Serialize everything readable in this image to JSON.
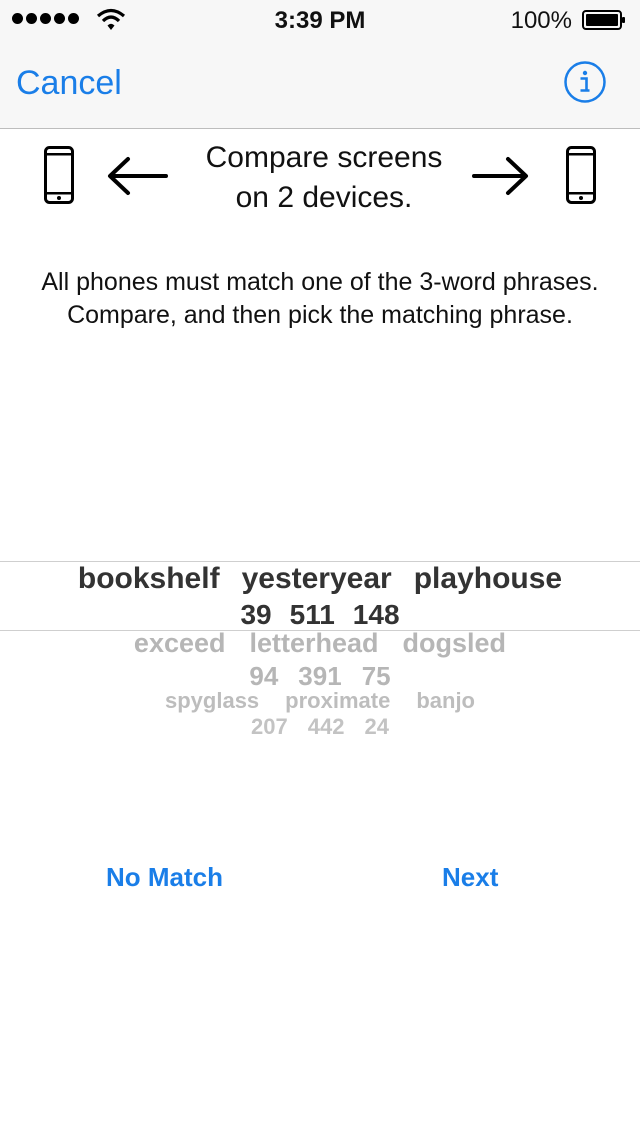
{
  "status_bar": {
    "time": "3:39 PM",
    "battery_percent": "100%",
    "signal_bars": 5,
    "icons": [
      "signal-dots-icon",
      "wifi-icon",
      "battery-icon"
    ]
  },
  "nav_bar": {
    "cancel_label": "Cancel",
    "info_icon": "info-icon",
    "accent_color": "#1a7ee8"
  },
  "header": {
    "title_line1": "Compare screens",
    "title_line2": "on 2 devices.",
    "left_icon": "phone-icon",
    "right_icon": "phone-icon",
    "left_arrow": "arrow-left-icon",
    "right_arrow": "arrow-right-icon"
  },
  "instructions": "All phones must match one of the 3-word phrases. Compare, and then pick the matching phrase.",
  "picker": {
    "options": [
      {
        "words": [
          "bookshelf",
          "yesteryear",
          "playhouse"
        ],
        "numbers": [
          "39",
          "511",
          "148"
        ],
        "selected": true
      },
      {
        "words": [
          "exceed",
          "letterhead",
          "dogsled"
        ],
        "numbers": [
          "94",
          "391",
          "75"
        ],
        "selected": false
      },
      {
        "words": [
          "spyglass",
          "proximate",
          "banjo"
        ],
        "numbers": [
          "207",
          "442",
          "24"
        ],
        "selected": false
      }
    ]
  },
  "actions": {
    "no_match_label": "No Match",
    "next_label": "Next"
  }
}
